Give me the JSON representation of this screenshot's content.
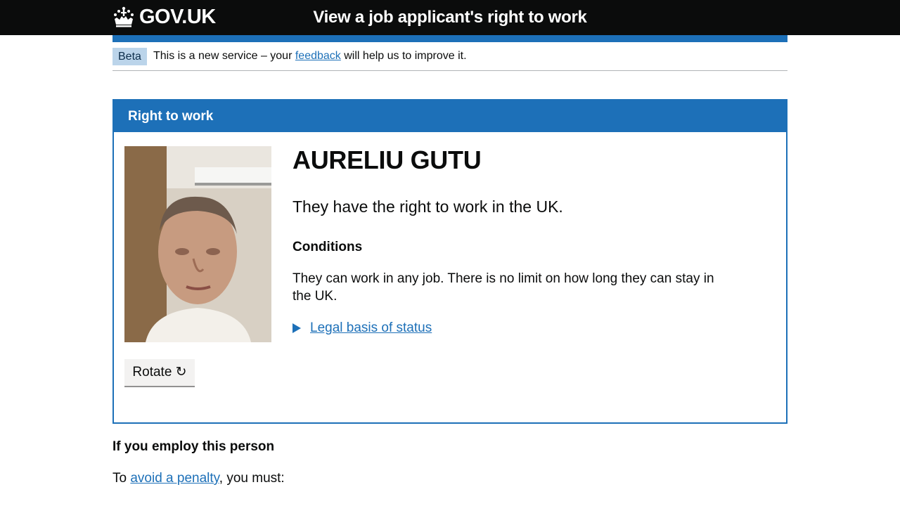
{
  "header": {
    "logo_text": "GOV.UK",
    "logo_icon": "crown-icon",
    "service_name": "View a job applicant's right to work"
  },
  "phase_banner": {
    "tag": "Beta",
    "text_before": "This is a new service – your",
    "link": "feedback",
    "text_after": "will help us to improve it."
  },
  "card": {
    "title": "Right to work",
    "name": "AURELIU GUTU",
    "status": "They have the right to work in the UK.",
    "conditions_title": "Conditions",
    "conditions_text": "They can work in any job. There is no limit on how long they can stay in the UK.",
    "details_summary": "Legal basis of status",
    "rotate_button": "Rotate ↻"
  },
  "employ": {
    "title": "If you employ this person",
    "text_before": "To",
    "link": "avoid a penalty",
    "text_after": ", you must:"
  },
  "colors": {
    "brand_blue": "#1d70b8",
    "header_black": "#0b0c0c",
    "beta_tag_bg": "#bbd4ea"
  }
}
